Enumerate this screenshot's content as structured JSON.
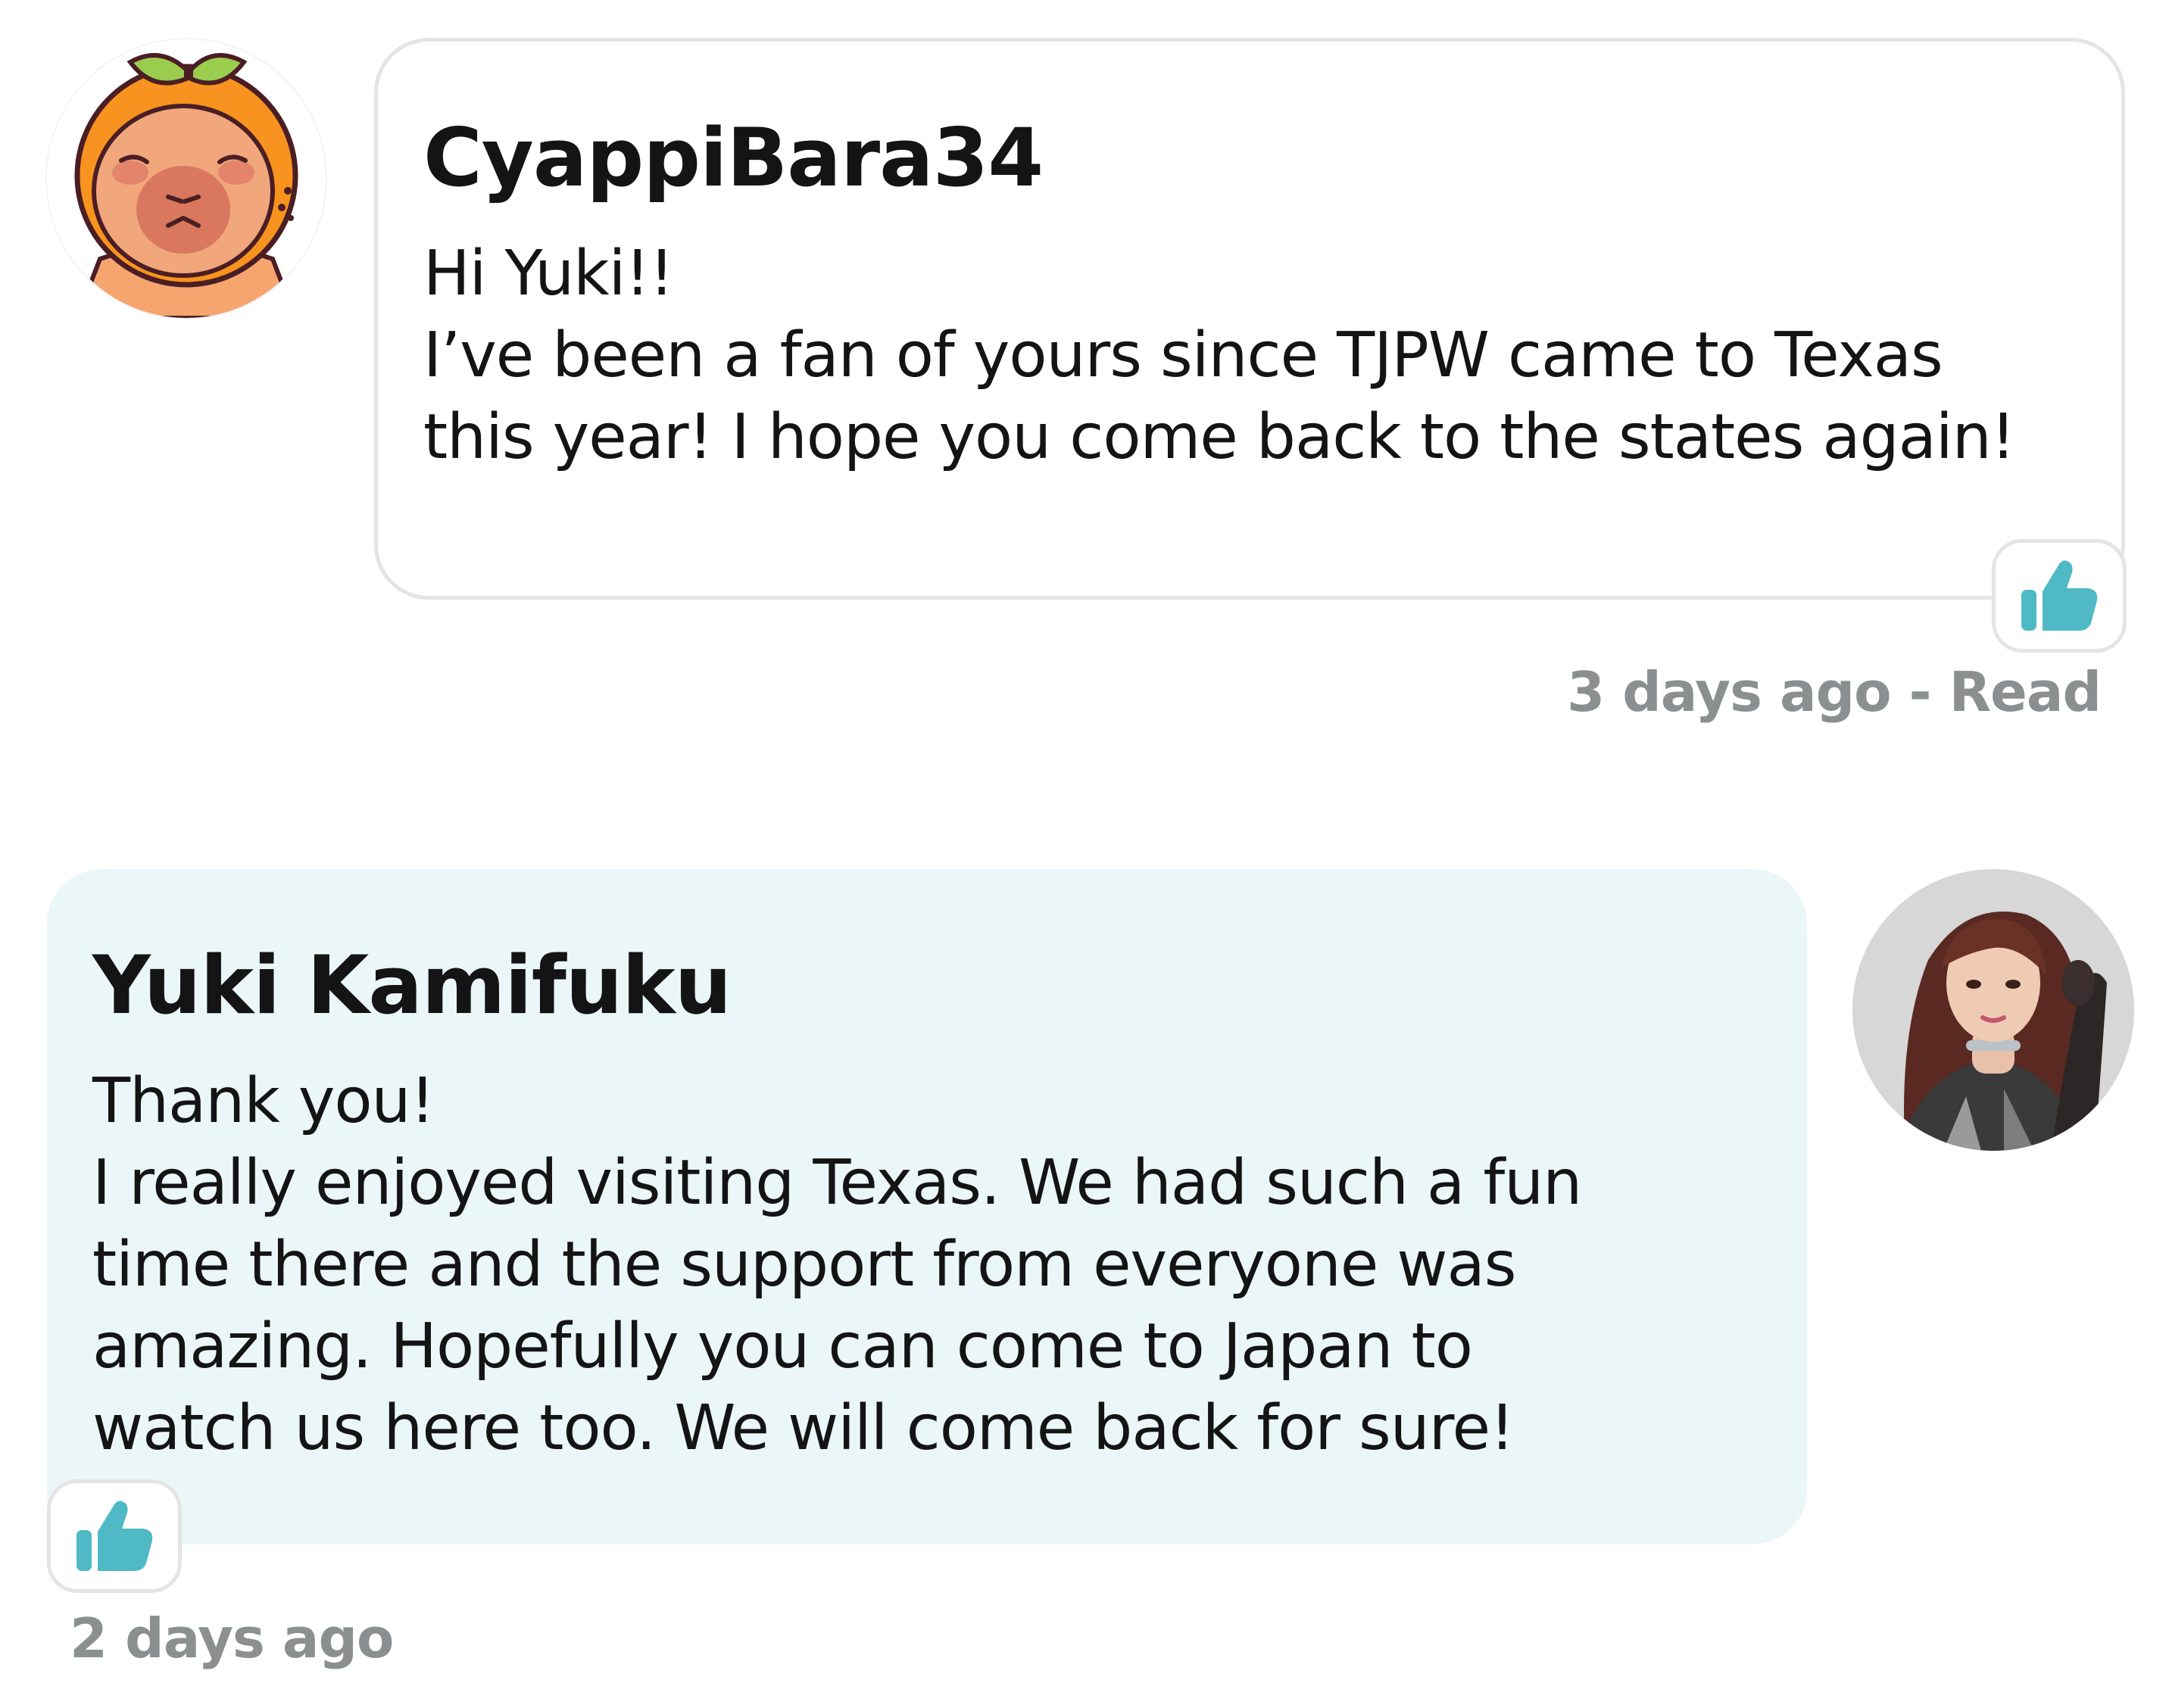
{
  "conversation": {
    "messages": [
      {
        "sender": "CyappiBara34",
        "lines": [
          "Hi Yuki!!",
          "I’ve been a fan of yours since TJPW came to Texas",
          "this year! I hope you come back to the states again!"
        ],
        "avatar_icon": "capybara-orange-avatar",
        "like_icon": "thumbs-up-icon",
        "meta": "3 days ago - Read"
      },
      {
        "sender": "Yuki Kamifuku",
        "lines": [
          "Thank you!",
          "I really enjoyed visiting Texas. We had such a fun",
          "time there and the support from everyone was",
          "amazing. Hopefully you can come to Japan to",
          "watch us here too. We will come back for sure!"
        ],
        "avatar_icon": "profile-photo",
        "like_icon": "thumbs-up-icon",
        "meta": "2 days ago"
      }
    ]
  },
  "colors": {
    "accent": "#4fb9c6",
    "incoming_bubble": "#ebf6f8",
    "border": "#e4e4e4",
    "meta_text": "#8b8f90",
    "avatar_orange": "#f6a56f"
  }
}
